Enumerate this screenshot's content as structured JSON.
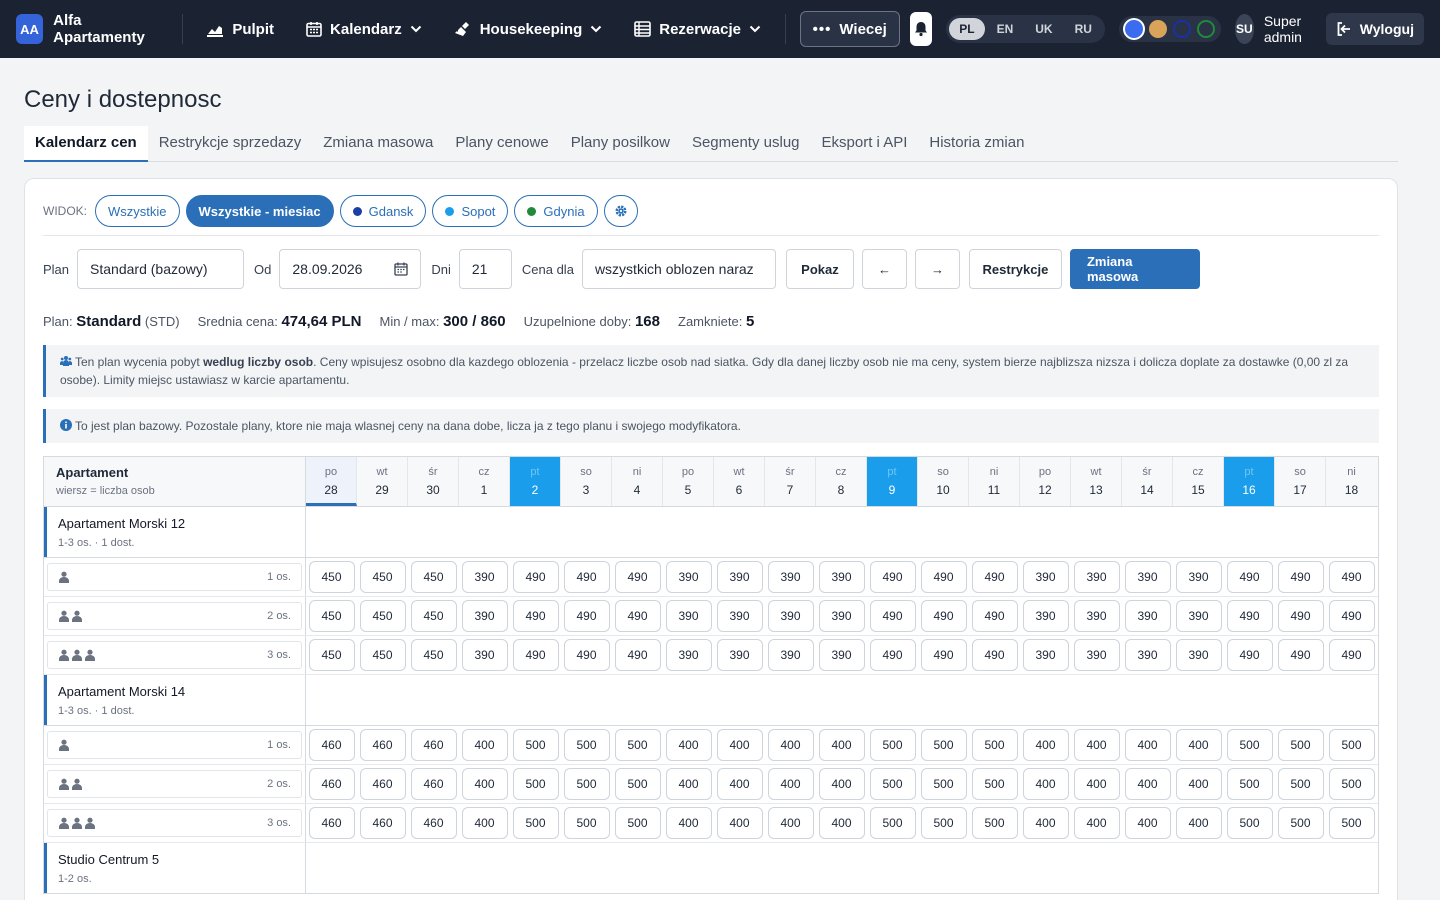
{
  "brand": {
    "initials": "AA",
    "name": "Alfa Apartamenty"
  },
  "nav": {
    "items": [
      {
        "label": "Pulpit",
        "icon": "chart-icon",
        "dropdown": false
      },
      {
        "label": "Kalendarz",
        "icon": "calendar-icon",
        "dropdown": true
      },
      {
        "label": "Housekeeping",
        "icon": "broom-icon",
        "dropdown": true
      },
      {
        "label": "Rezerwacje",
        "icon": "list-icon",
        "dropdown": true
      }
    ],
    "more_label": "Wiecej",
    "languages": [
      "PL",
      "EN",
      "UK",
      "RU"
    ],
    "active_language": "PL",
    "theme_colors": [
      "#3b6cf0",
      "#d9a45a",
      "#1b2fa8",
      "#1f8a3b"
    ],
    "user_initials": "SU",
    "user_name": "Super admin",
    "logout_label": "Wyloguj"
  },
  "page": {
    "title": "Ceny i dostepnosc",
    "tabs": [
      "Kalendarz cen",
      "Restrykcje sprzedazy",
      "Zmiana masowa",
      "Plany cenowe",
      "Plany posilkow",
      "Segmenty uslug",
      "Eksport i API",
      "Historia zmian"
    ],
    "active_tab": 0
  },
  "view": {
    "label": "WIDOK:",
    "chips": [
      {
        "label": "Wszystkie",
        "active": false,
        "dot": null
      },
      {
        "label": "Wszystkie - miesiac",
        "active": true,
        "dot": null
      },
      {
        "label": "Gdansk",
        "active": false,
        "dot": "#1b3fa8"
      },
      {
        "label": "Sopot",
        "active": false,
        "dot": "#1a9dea"
      },
      {
        "label": "Gdynia",
        "active": false,
        "dot": "#1f8a3b"
      }
    ]
  },
  "filters": {
    "plan_label": "Plan",
    "plan_value": "Standard (bazowy)",
    "from_label": "Od",
    "from_value": "28.09.2026",
    "days_label": "Dni",
    "days_value": "21",
    "price_for_label": "Cena dla",
    "price_for_value": "wszystkich oblozen naraz",
    "show_label": "Pokaz",
    "prev_label": "←",
    "next_label": "→",
    "restrictions_label": "Restrykcje",
    "mass_change_label": "Zmiana masowa"
  },
  "summary": {
    "plan_prefix": "Plan:",
    "plan_name": "Standard",
    "plan_code": "(STD)",
    "avg_label": "Srednia cena:",
    "avg_value": "474,64 PLN",
    "minmax_label": "Min / max:",
    "minmax_value": "300 / 860",
    "filled_label": "Uzupelnione doby:",
    "filled_value": "168",
    "closed_label": "Zamkniete:",
    "closed_value": "5"
  },
  "notes": {
    "occupancy_pre": "Ten plan wycenia pobyt ",
    "occupancy_bold": "wedlug liczby osob",
    "occupancy_post": ". Ceny wpisujesz osobno dla kazdego oblozenia - przelacz liczbe osob nad siatka. Gdy dla danej liczby osob nie ma ceny, system bierze najblizsza nizsza i dolicza doplate za dostawke (0,00 zl za osobe). Limity miejsc ustawiasz w karcie apartamentu.",
    "base_plan": "To jest plan bazowy. Pozostale plany, ktore nie maja wlasnej ceny na dana dobe, licza ja z tego planu i swojego modyfikatora."
  },
  "grid": {
    "head_title": "Apartament",
    "head_sub": "wiersz = liczba osob",
    "days": [
      {
        "dow": "po",
        "day": "28",
        "today": true,
        "friday": false
      },
      {
        "dow": "wt",
        "day": "29",
        "today": false,
        "friday": false
      },
      {
        "dow": "śr",
        "day": "30",
        "today": false,
        "friday": false
      },
      {
        "dow": "cz",
        "day": "1",
        "today": false,
        "friday": false
      },
      {
        "dow": "pt",
        "day": "2",
        "today": false,
        "friday": true
      },
      {
        "dow": "so",
        "day": "3",
        "today": false,
        "friday": false
      },
      {
        "dow": "ni",
        "day": "4",
        "today": false,
        "friday": false
      },
      {
        "dow": "po",
        "day": "5",
        "today": false,
        "friday": false
      },
      {
        "dow": "wt",
        "day": "6",
        "today": false,
        "friday": false
      },
      {
        "dow": "śr",
        "day": "7",
        "today": false,
        "friday": false
      },
      {
        "dow": "cz",
        "day": "8",
        "today": false,
        "friday": false
      },
      {
        "dow": "pt",
        "day": "9",
        "today": false,
        "friday": true
      },
      {
        "dow": "so",
        "day": "10",
        "today": false,
        "friday": false
      },
      {
        "dow": "ni",
        "day": "11",
        "today": false,
        "friday": false
      },
      {
        "dow": "po",
        "day": "12",
        "today": false,
        "friday": false
      },
      {
        "dow": "wt",
        "day": "13",
        "today": false,
        "friday": false
      },
      {
        "dow": "śr",
        "day": "14",
        "today": false,
        "friday": false
      },
      {
        "dow": "cz",
        "day": "15",
        "today": false,
        "friday": false
      },
      {
        "dow": "pt",
        "day": "16",
        "today": false,
        "friday": true
      },
      {
        "dow": "so",
        "day": "17",
        "today": false,
        "friday": false
      },
      {
        "dow": "ni",
        "day": "18",
        "today": false,
        "friday": false
      }
    ],
    "apartments": [
      {
        "name": "Apartament Morski 12",
        "sub": "1-3 os. · 1 dost.",
        "rows": [
          {
            "persons": 1,
            "label": "1 os.",
            "prices": [
              "450",
              "450",
              "450",
              "390",
              "490",
              "490",
              "490",
              "390",
              "390",
              "390",
              "390",
              "490",
              "490",
              "490",
              "390",
              "390",
              "390",
              "390",
              "490",
              "490",
              "490"
            ]
          },
          {
            "persons": 2,
            "label": "2 os.",
            "prices": [
              "450",
              "450",
              "450",
              "390",
              "490",
              "490",
              "490",
              "390",
              "390",
              "390",
              "390",
              "490",
              "490",
              "490",
              "390",
              "390",
              "390",
              "390",
              "490",
              "490",
              "490"
            ]
          },
          {
            "persons": 3,
            "label": "3 os.",
            "prices": [
              "450",
              "450",
              "450",
              "390",
              "490",
              "490",
              "490",
              "390",
              "390",
              "390",
              "390",
              "490",
              "490",
              "490",
              "390",
              "390",
              "390",
              "390",
              "490",
              "490",
              "490"
            ]
          }
        ]
      },
      {
        "name": "Apartament Morski 14",
        "sub": "1-3 os. · 1 dost.",
        "rows": [
          {
            "persons": 1,
            "label": "1 os.",
            "prices": [
              "460",
              "460",
              "460",
              "400",
              "500",
              "500",
              "500",
              "400",
              "400",
              "400",
              "400",
              "500",
              "500",
              "500",
              "400",
              "400",
              "400",
              "400",
              "500",
              "500",
              "500"
            ]
          },
          {
            "persons": 2,
            "label": "2 os.",
            "prices": [
              "460",
              "460",
              "460",
              "400",
              "500",
              "500",
              "500",
              "400",
              "400",
              "400",
              "400",
              "500",
              "500",
              "500",
              "400",
              "400",
              "400",
              "400",
              "500",
              "500",
              "500"
            ]
          },
          {
            "persons": 3,
            "label": "3 os.",
            "prices": [
              "460",
              "460",
              "460",
              "400",
              "500",
              "500",
              "500",
              "400",
              "400",
              "400",
              "400",
              "500",
              "500",
              "500",
              "400",
              "400",
              "400",
              "400",
              "500",
              "500",
              "500"
            ]
          }
        ]
      },
      {
        "name": "Studio Centrum 5",
        "sub": "1-2 os.",
        "rows": []
      }
    ]
  }
}
